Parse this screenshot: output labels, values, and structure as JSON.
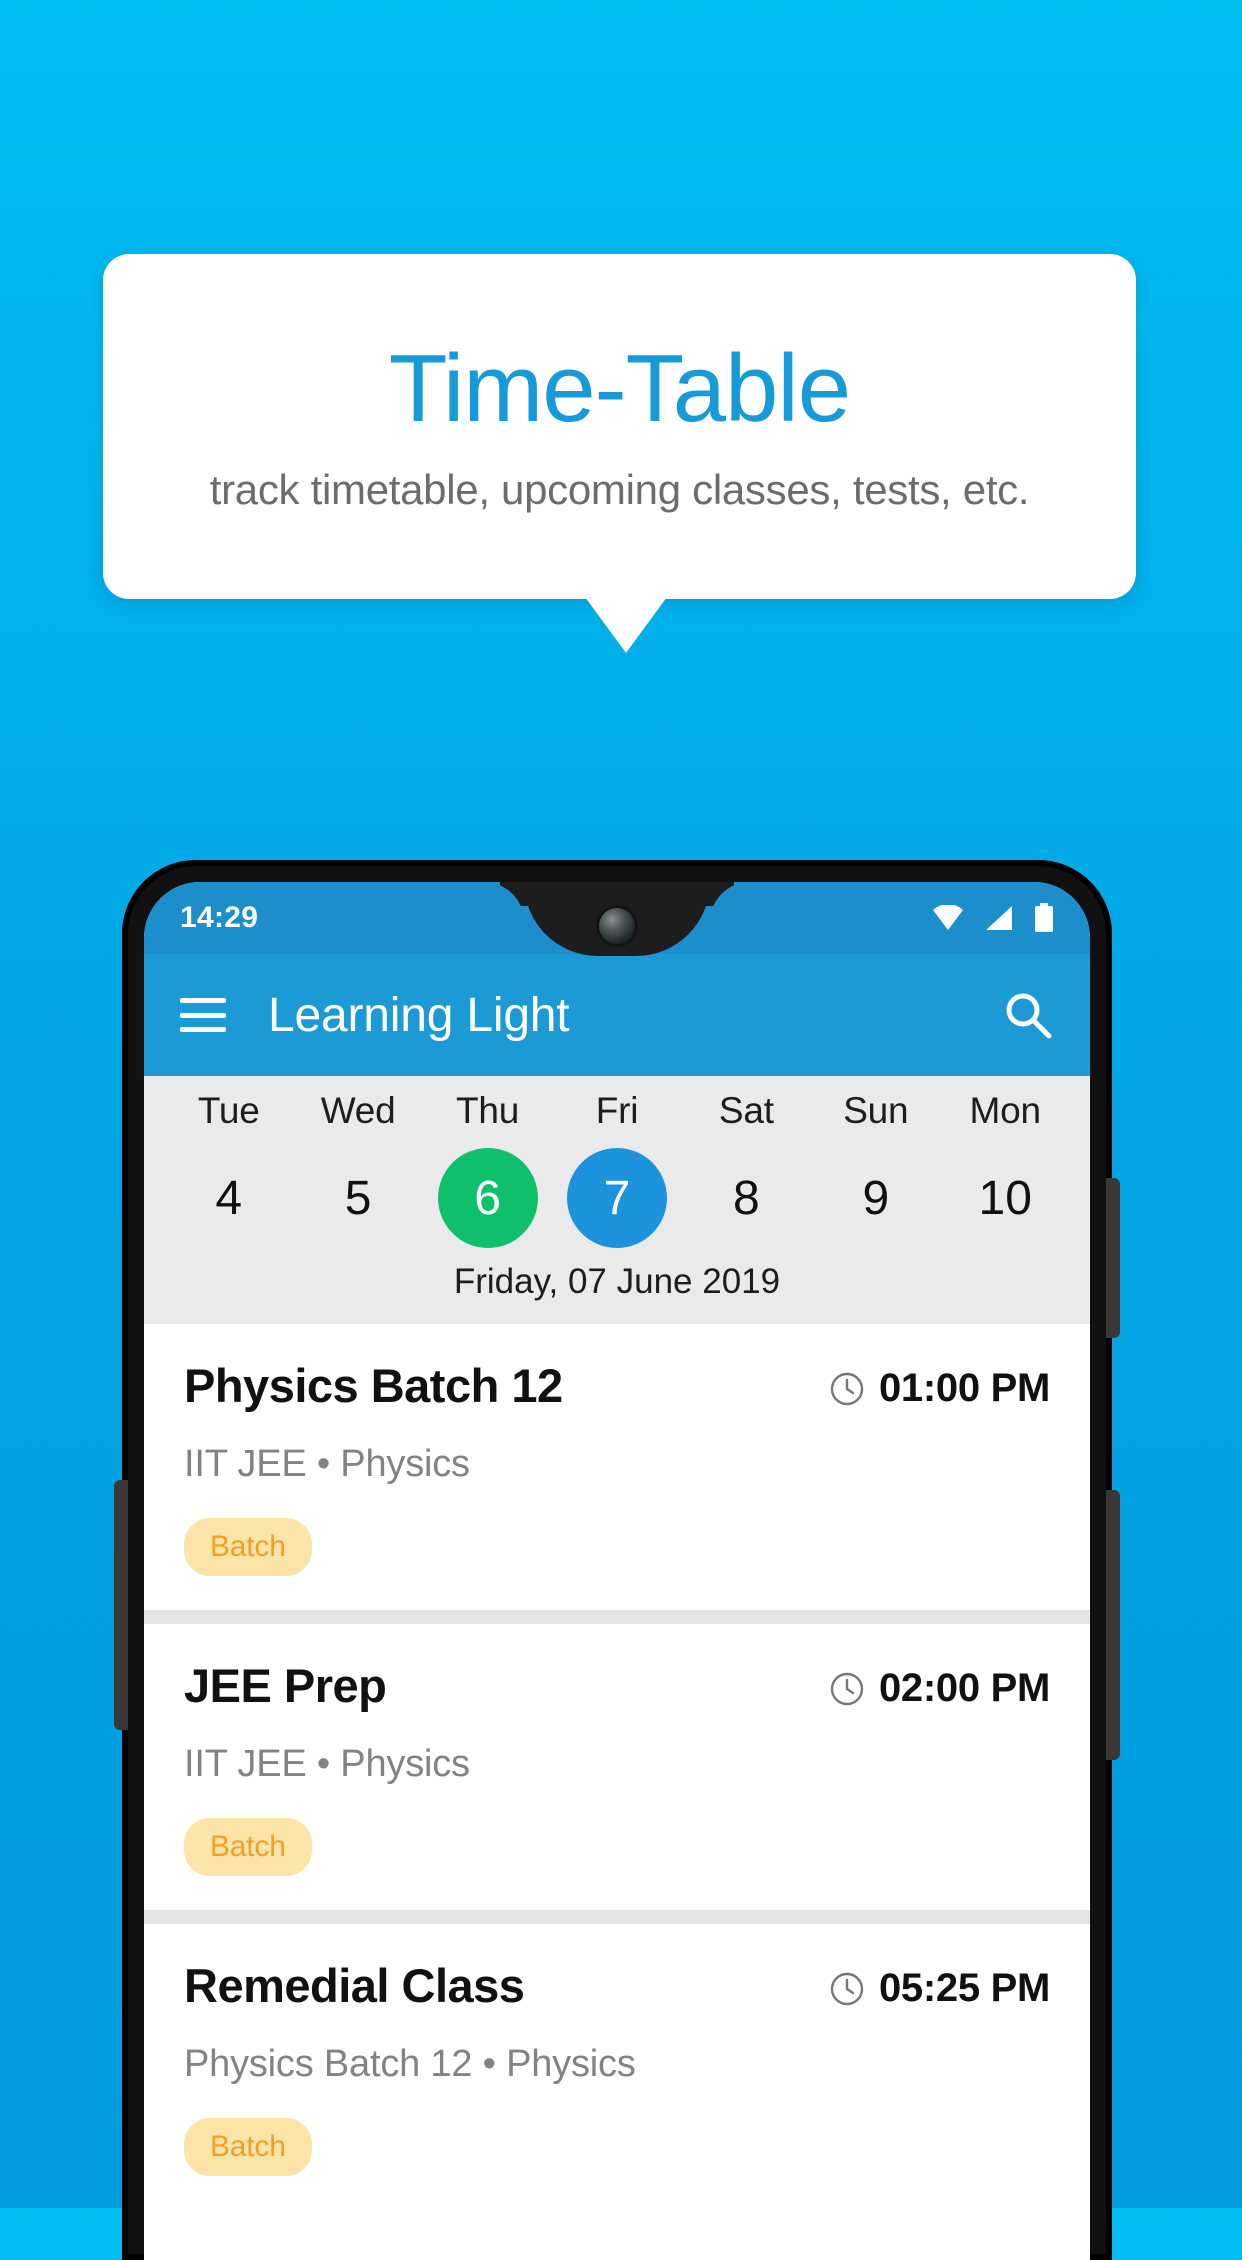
{
  "promo": {
    "title": "Time-Table",
    "subtitle": "track timetable, upcoming classes, tests, etc.",
    "title_color": "#169BD8",
    "card_bg": "#FFFFFF"
  },
  "background": {
    "gradient_top": "#00BDF0",
    "gradient_bottom": "#029CDF"
  },
  "phone": {
    "status_bar": {
      "time": "14:29",
      "icons": [
        "wifi-icon",
        "signal-icon",
        "battery-icon"
      ],
      "bg_color": "#1B8ECB"
    },
    "app_bar": {
      "menu_icon": "hamburger-menu-icon",
      "title": "Learning Light",
      "search_icon": "search-icon",
      "bg_color": "#1C9AD6"
    },
    "date_strip": {
      "bg_color": "#EAEAEA",
      "today_color": "#0FBF6C",
      "selected_color": "#1C93DC",
      "days": [
        {
          "dow": "Tue",
          "num": "4",
          "state": ""
        },
        {
          "dow": "Wed",
          "num": "5",
          "state": ""
        },
        {
          "dow": "Thu",
          "num": "6",
          "state": "today"
        },
        {
          "dow": "Fri",
          "num": "7",
          "state": "selected"
        },
        {
          "dow": "Sat",
          "num": "8",
          "state": ""
        },
        {
          "dow": "Sun",
          "num": "9",
          "state": ""
        },
        {
          "dow": "Mon",
          "num": "10",
          "state": ""
        }
      ],
      "full_date": "Friday, 07 June 2019"
    },
    "classes": [
      {
        "title": "Physics Batch 12",
        "time": "01:00 PM",
        "time_icon": "clock-icon",
        "subtitle": "IIT JEE • Physics",
        "chip": "Batch",
        "chip_bg": "#FCE3A8",
        "chip_color": "#EDA126"
      },
      {
        "title": "JEE Prep",
        "time": "02:00 PM",
        "time_icon": "clock-icon",
        "subtitle": "IIT JEE • Physics",
        "chip": "Batch",
        "chip_bg": "#FCE3A8",
        "chip_color": "#EDA126"
      },
      {
        "title": "Remedial Class",
        "time": "05:25 PM",
        "time_icon": "clock-icon",
        "subtitle": "Physics Batch 12 • Physics",
        "chip": "Batch",
        "chip_bg": "#FCE3A8",
        "chip_color": "#EDA126"
      }
    ]
  }
}
